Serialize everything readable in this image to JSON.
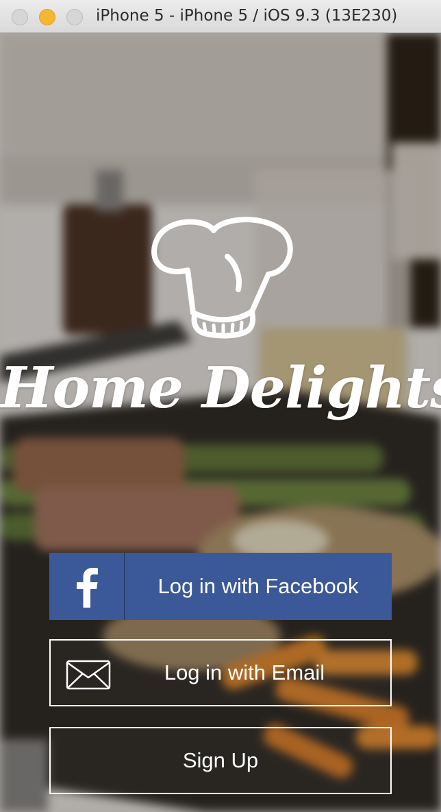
{
  "window": {
    "title": "iPhone 5 - iPhone 5 / iOS 9.3 (13E230)"
  },
  "app": {
    "name": "Home Delights",
    "logo_icon": "chef-hat-icon"
  },
  "buttons": {
    "facebook_label": "Log in with Facebook",
    "facebook_icon": "facebook-icon",
    "email_label": "Log in with Email",
    "email_icon": "envelope-icon",
    "signup_label": "Sign Up"
  },
  "colors": {
    "facebook_blue": "#3b5998",
    "text": "#ffffff",
    "traffic_minimize": "#f5b731"
  }
}
